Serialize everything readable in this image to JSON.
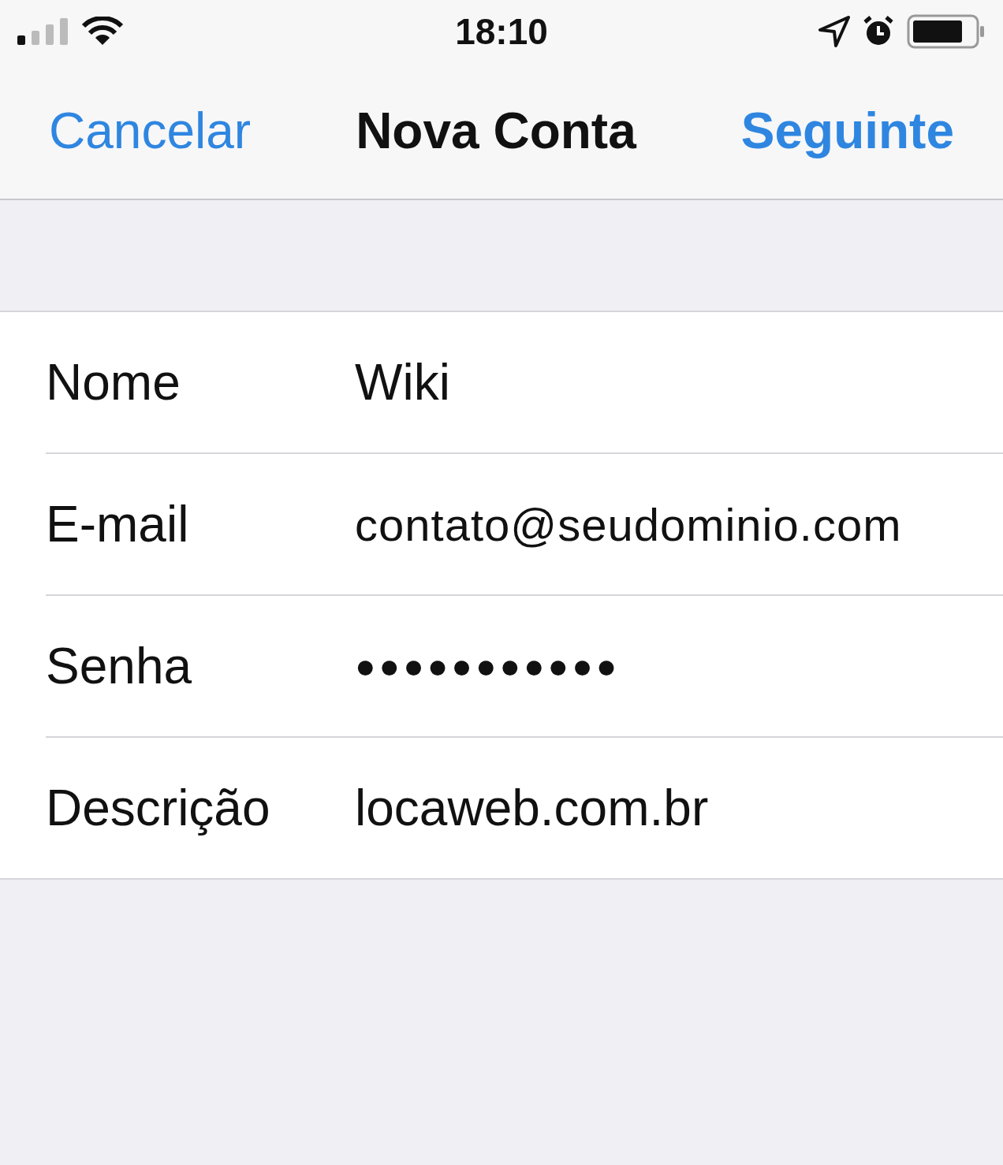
{
  "status_bar": {
    "time": "18:10"
  },
  "nav_bar": {
    "cancel": "Cancelar",
    "title": "Nova Conta",
    "next": "Seguinte"
  },
  "form": {
    "rows": [
      {
        "label": "Nome",
        "value": "Wiki",
        "kind": "text"
      },
      {
        "label": "E-mail",
        "value": "contato@seudominio.com",
        "kind": "email"
      },
      {
        "label": "Senha",
        "value": "●●●●●●●●●●●",
        "kind": "password"
      },
      {
        "label": "Descrição",
        "value": "locaweb.com.br",
        "kind": "text"
      }
    ]
  }
}
